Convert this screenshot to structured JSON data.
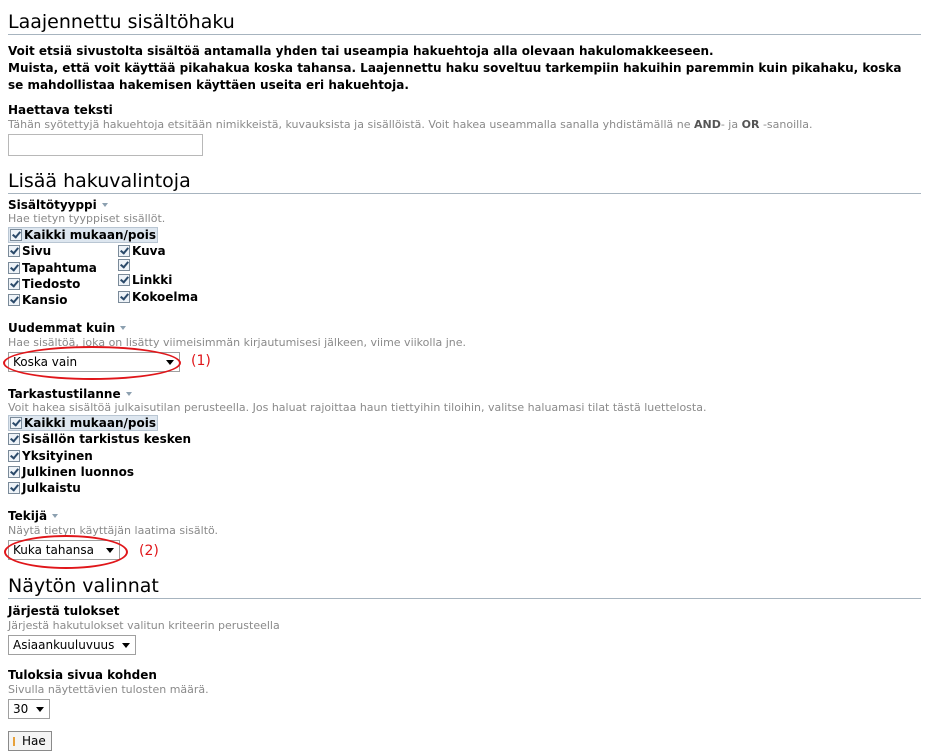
{
  "search_section": {
    "title": "Laajennettu sisältöhaku",
    "intro_line1": "Voit etsiä sivustolta sisältöä antamalla yhden tai useampia hakuehtoja alla olevaan hakulomakkeeseen.",
    "intro_line2": "Muista, että voit käyttää pikahakua koska tahansa. Laajennettu haku soveltuu tarkempiin hakuihin paremmin kuin pikahaku, koska se mahdollistaa hakemisen käyttäen useita eri hakuehtoja.",
    "text_label": "Haettava teksti",
    "text_help_pre": "Tähän syötettyjä hakuehtoja etsitään nimikkeistä, kuvauksista ja sisällöistä. Voit hakea useammalla sanalla yhdistämällä ne",
    "text_help_and": "AND",
    "text_help_mid": "- ja",
    "text_help_or": "OR",
    "text_help_post": "-sanoilla.",
    "text_value": ""
  },
  "options_section": {
    "title": "Lisää hakuvalintoja",
    "content_type": {
      "label": "Sisältötyyppi",
      "help": "Hae tietyn tyyppiset sisällöt.",
      "toggle_all": "Kaikki mukaan/pois",
      "col1": [
        "Sivu",
        "Tapahtuma",
        "Tiedosto",
        "Kansio"
      ],
      "col2": [
        "Kuva",
        "",
        "Linkki",
        "Kokoelma"
      ]
    },
    "newer_than": {
      "label": "Uudemmat kuin",
      "help": "Hae sisältöä, joka on lisätty viimeisimmän kirjautumisesi jälkeen, viime viikolla jne.",
      "selected": "Koska vain",
      "marker": "(1)"
    },
    "review_state": {
      "label": "Tarkastustilanne",
      "help": "Voit hakea sisältöä julkaisutilan perusteella. Jos haluat rajoittaa haun tiettyihin tiloihin, valitse haluamasi tilat tästä luettelosta.",
      "toggle_all": "Kaikki mukaan/pois",
      "items": [
        "Sisällön tarkistus kesken",
        "Yksityinen",
        "Julkinen luonnos",
        "Julkaistu"
      ]
    },
    "author": {
      "label": "Tekijä",
      "help": "Näytä tietyn käyttäjän laatima sisältö.",
      "selected": "Kuka tahansa",
      "marker": "(2)"
    }
  },
  "display_section": {
    "title": "Näytön valinnat",
    "sort": {
      "label": "Järjestä tulokset",
      "help": "Järjestä hakutulokset valitun kriteerin perusteella",
      "selected": "Asiaankuuluvuus"
    },
    "per_page": {
      "label": "Tuloksia sivua kohden",
      "help": "Sivulla näytettävien tulosten määrä.",
      "selected": "30"
    },
    "submit_label": "Hae"
  },
  "colors": {
    "annotation": "#e0161a",
    "rule": "#a7b4bf"
  }
}
